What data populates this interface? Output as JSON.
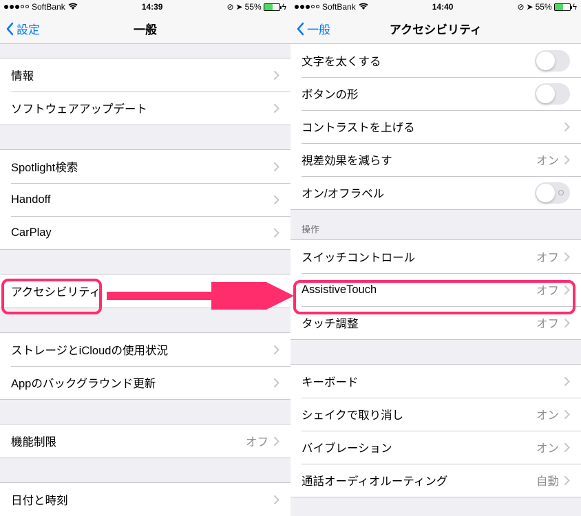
{
  "left": {
    "status": {
      "carrier": "SoftBank",
      "time": "14:39",
      "battery": "55%"
    },
    "nav": {
      "back": "設定",
      "title": "一般"
    },
    "rows": {
      "info": "情報",
      "software_update": "ソフトウェアアップデート",
      "spotlight": "Spotlight検索",
      "handoff": "Handoff",
      "carplay": "CarPlay",
      "accessibility": "アクセシビリティ",
      "storage": "ストレージとiCloudの使用状況",
      "bg_refresh": "Appのバックグラウンド更新",
      "restrictions": "機能制限",
      "restrictions_value": "オフ",
      "datetime": "日付と時刻"
    }
  },
  "right": {
    "status": {
      "carrier": "SoftBank",
      "time": "14:40",
      "battery": "55%"
    },
    "nav": {
      "back": "一般",
      "title": "アクセシビリティ"
    },
    "rows": {
      "bold_text": "文字を太くする",
      "button_shapes": "ボタンの形",
      "increase_contrast": "コントラストを上げる",
      "reduce_motion": "視差効果を減らす",
      "reduce_motion_value": "オン",
      "on_off_labels": "オン/オフラベル",
      "section_interaction": "操作",
      "switch_control": "スイッチコントロール",
      "switch_control_value": "オフ",
      "assistive_touch": "AssistiveTouch",
      "assistive_touch_value": "オフ",
      "touch_accom": "タッチ調整",
      "touch_accom_value": "オフ",
      "keyboard": "キーボード",
      "shake_undo": "シェイクで取り消し",
      "shake_undo_value": "オン",
      "vibration": "バイブレーション",
      "vibration_value": "オン",
      "call_audio": "通話オーディオルーティング",
      "call_audio_value": "自動"
    }
  }
}
